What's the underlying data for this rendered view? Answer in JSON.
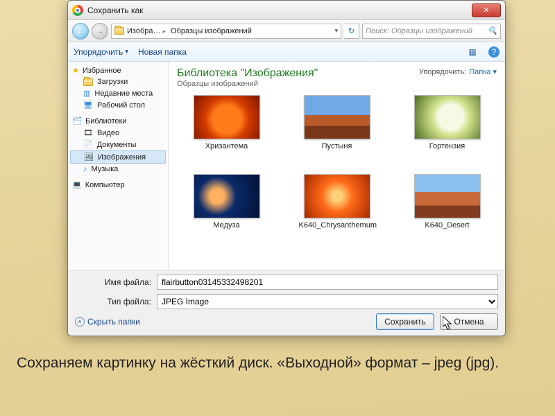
{
  "dialog": {
    "title": "Сохранить как",
    "close": "✕",
    "nav": {
      "path_root_icon": "folder",
      "seg1": "Изобра…",
      "seg2": "Образцы изображений",
      "refresh": "↻",
      "search_placeholder": "Поиск: Образцы изображений",
      "search_icon": "🔍"
    },
    "toolbar": {
      "organize": "Упорядочить",
      "newfolder": "Новая папка",
      "views_icon": "▦",
      "help_icon": "?"
    },
    "sidebar": {
      "favorites": "Избранное",
      "downloads": "Загрузки",
      "recent": "Недавние места",
      "desktop": "Рабочий стол",
      "libraries": "Библиотеки",
      "video": "Видео",
      "documents": "Документы",
      "pictures": "Изображения",
      "music": "Музыка",
      "computer": "Компьютер"
    },
    "library": {
      "title": "Библиотека \"Изображения\"",
      "subtitle": "Образцы изображений",
      "sort_label": "Упорядочить:",
      "sort_value": "Папка"
    },
    "thumbs": [
      {
        "label": "Хризантема",
        "cls": "flower1"
      },
      {
        "label": "Пустыня",
        "cls": "desert"
      },
      {
        "label": "Гортензия",
        "cls": "flower2"
      },
      {
        "label": "Медуза",
        "cls": "jelly"
      },
      {
        "label": "K640_Chrysanthemum",
        "cls": "flower3"
      },
      {
        "label": "K640_Desert",
        "cls": "desert2"
      }
    ],
    "fields": {
      "name_label": "Имя файла:",
      "name_value": "flairbutton03145332498201",
      "type_label": "Тип файла:",
      "type_value": "JPEG Image"
    },
    "actions": {
      "hide": "Скрыть папки",
      "save": "Сохранить",
      "cancel": "Отмена"
    }
  },
  "caption": "Сохраняем картинку на жёсткий диск. «Выходной» формат – jpeg (jpg)."
}
